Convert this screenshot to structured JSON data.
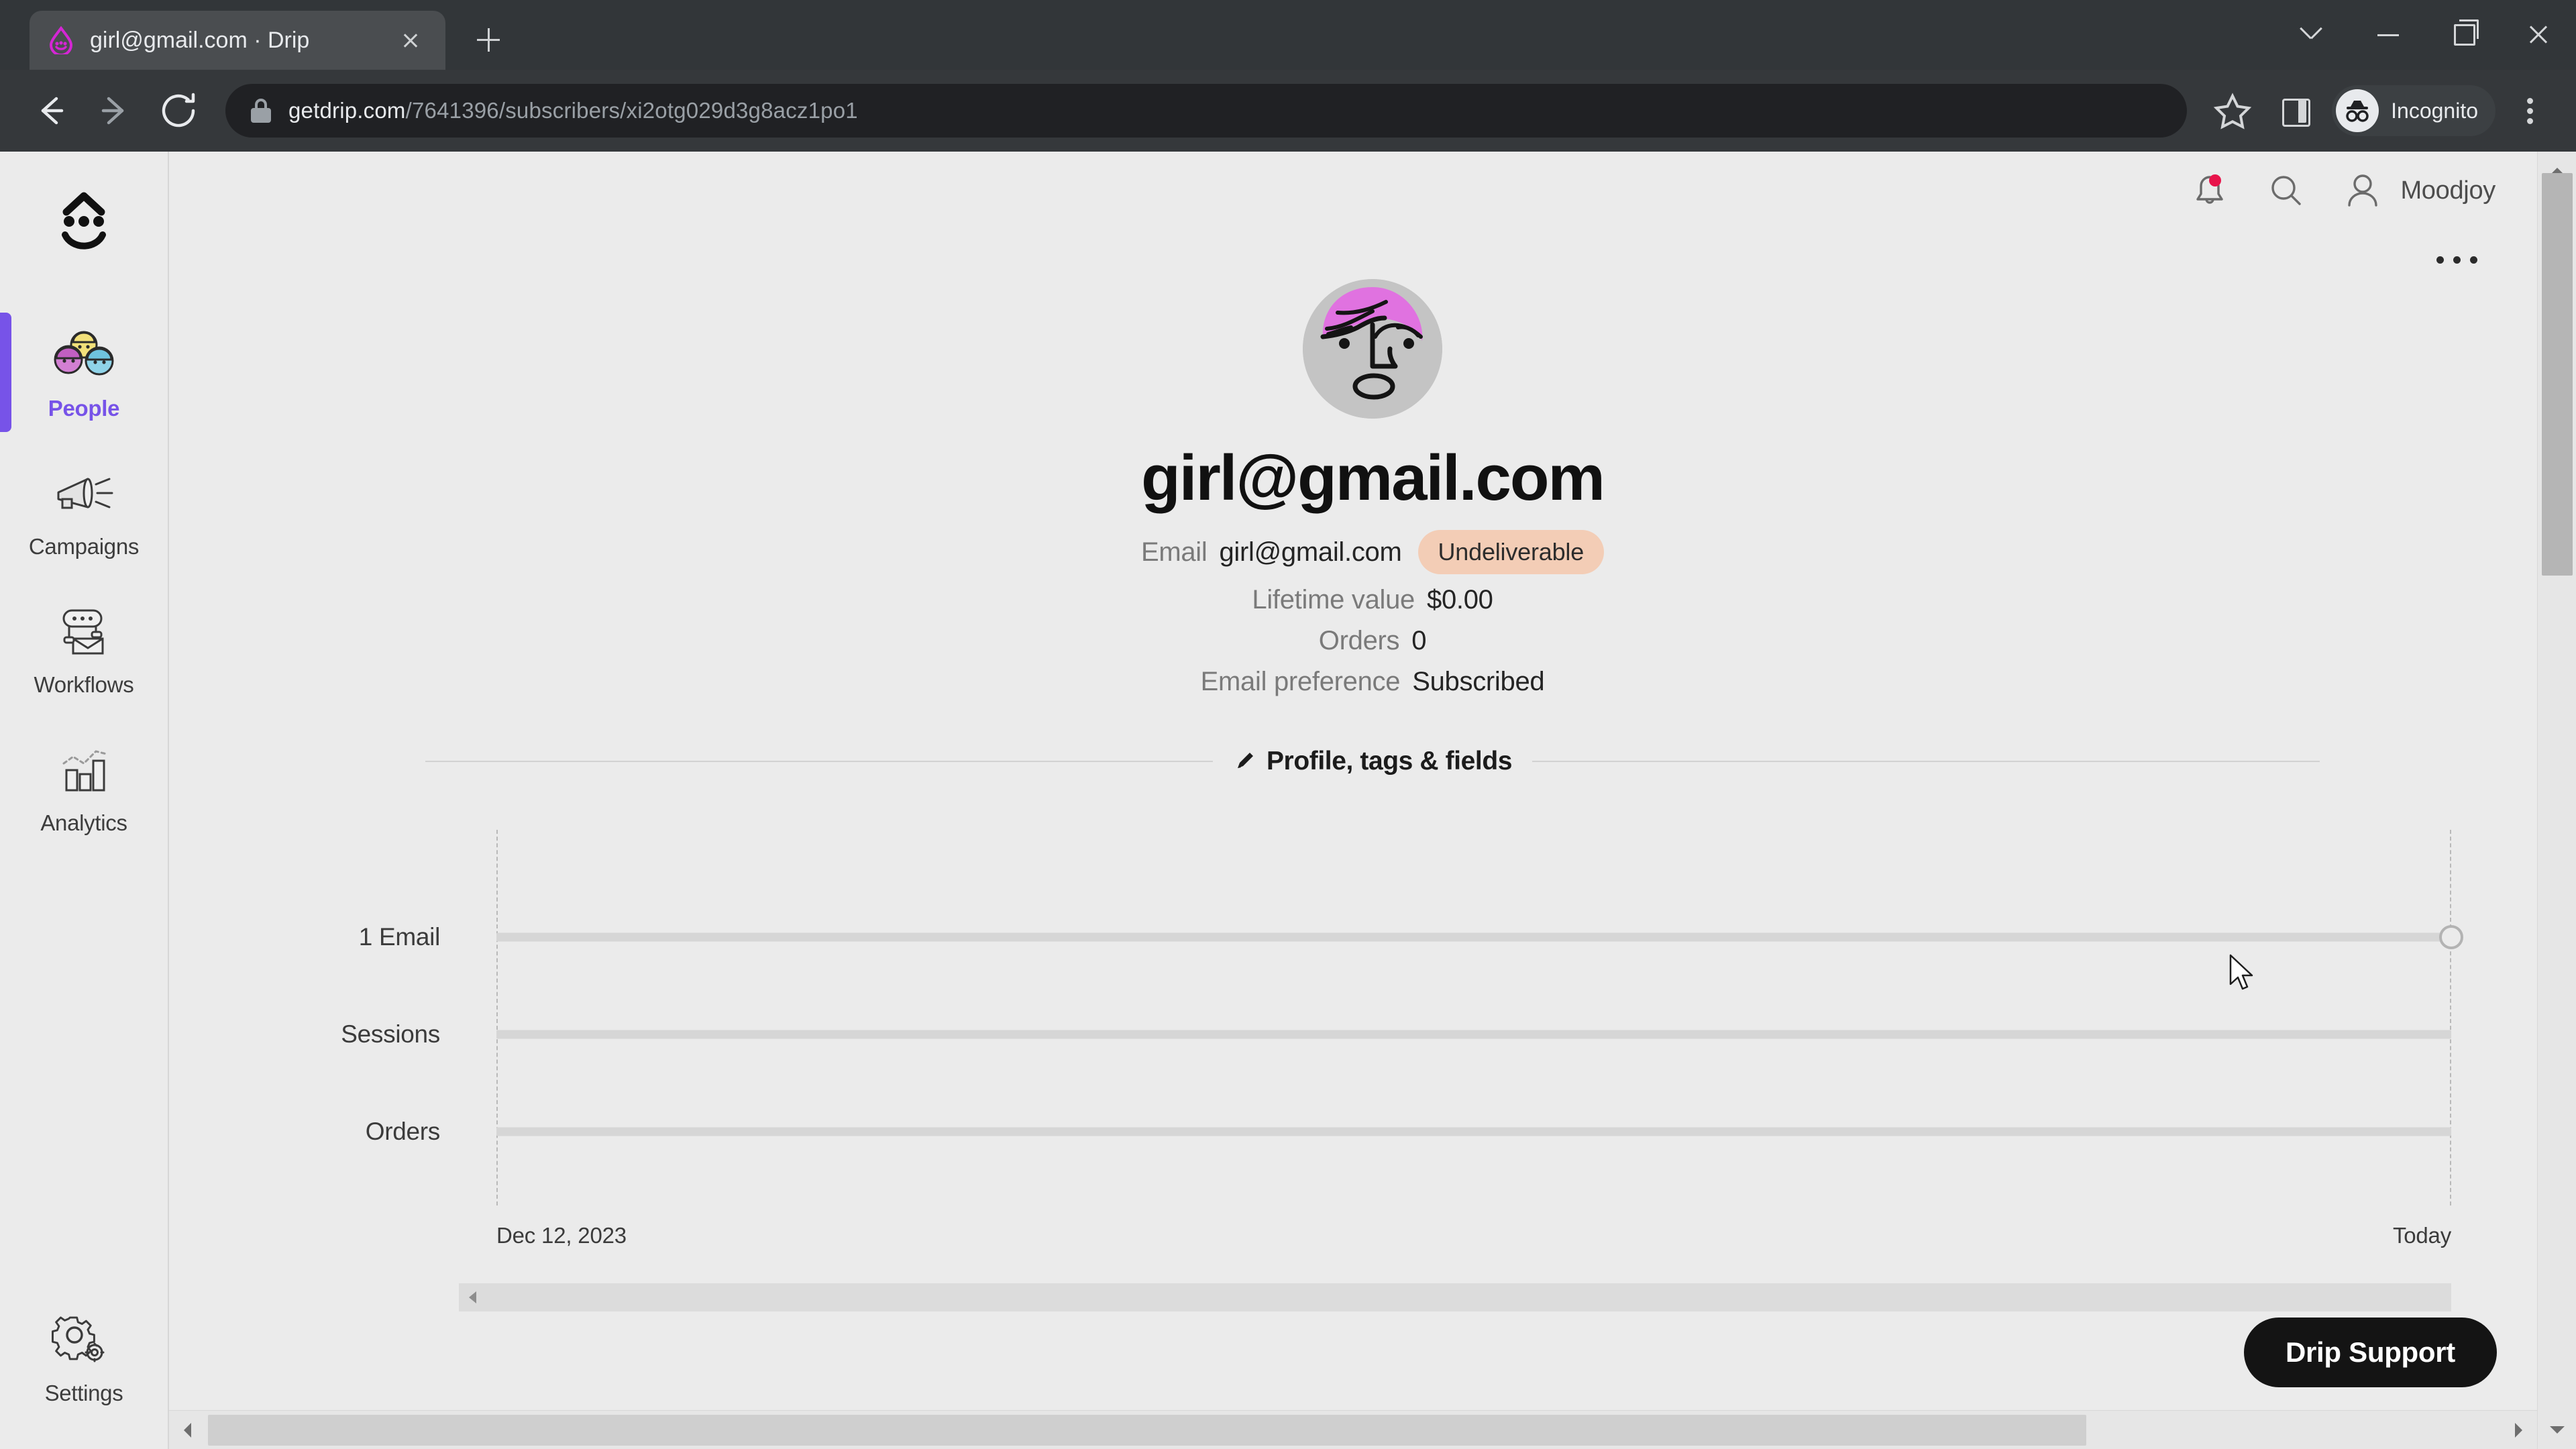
{
  "browser": {
    "tab": {
      "title": "girl@gmail.com · Drip",
      "favicon_name": "drip-logo-favicon",
      "close_name": "tab-close-icon"
    },
    "new_tab_label": "+",
    "window_controls": [
      "chevron-down-icon",
      "minimize-icon",
      "restore-icon",
      "close-icon"
    ],
    "toolbar": {
      "back_name": "back-arrow-icon",
      "forward_name": "forward-arrow-icon",
      "reload_name": "reload-icon",
      "lock_name": "lock-icon",
      "url_host": "getdrip.com",
      "url_path": "/7641396/subscribers/xi2otg029d3g8acz1po1",
      "star_name": "bookmark-star-icon",
      "side_panel_name": "side-panel-icon",
      "incognito_label": "Incognito",
      "menu_name": "browser-menu-icon"
    }
  },
  "sidebar": {
    "brand_name": "drip-smile-logo",
    "items": [
      {
        "label": "People",
        "icon": "people-icon",
        "active": true
      },
      {
        "label": "Campaigns",
        "icon": "megaphone-icon",
        "active": false
      },
      {
        "label": "Workflows",
        "icon": "workflow-icon",
        "active": false
      },
      {
        "label": "Analytics",
        "icon": "bar-chart-icon",
        "active": false
      },
      {
        "label": "Settings",
        "icon": "gear-icon",
        "active": false
      }
    ],
    "active_color": "#7753e8"
  },
  "header": {
    "notifications_name": "bell-icon",
    "notification_dot_color": "#e8144b",
    "search_name": "search-icon",
    "account_icon_name": "person-icon",
    "account_name": "Moodjoy"
  },
  "subscriber": {
    "more_menu_name": "more-options-icon",
    "avatar_name": "subscriber-avatar",
    "avatar_hair_color": "#e072e0",
    "avatar_face_color": "#c4c4c4",
    "name": "girl@gmail.com",
    "fields": [
      {
        "label": "Email",
        "value": "girl@gmail.com",
        "badge": "Undeliverable"
      },
      {
        "label": "Lifetime value",
        "value": "$0.00",
        "badge": null
      },
      {
        "label": "Orders",
        "value": "0",
        "badge": null
      },
      {
        "label": "Email preference",
        "value": "Subscribed",
        "badge": null
      }
    ],
    "badge_bg": "#f3cdb6"
  },
  "section": {
    "edit_icon": "pencil-icon",
    "label": "Profile, tags & fields"
  },
  "chart_data": {
    "type": "timeline",
    "title": "",
    "categories": [
      "1 Email",
      "Sessions",
      "Orders"
    ],
    "series": [
      {
        "name": "1 Email",
        "value": 1,
        "marker_at": "Today",
        "has_marker": true
      },
      {
        "name": "Sessions",
        "value": 0,
        "marker_at": null,
        "has_marker": false
      },
      {
        "name": "Orders",
        "value": 0,
        "marker_at": null,
        "has_marker": false
      }
    ],
    "x_axis": {
      "start_label": "Dec 12, 2023",
      "end_label": "Today"
    },
    "grid": false,
    "legend": "none"
  },
  "support": {
    "label": "Drip Support"
  },
  "scrollbars": {
    "vertical_name": "page-vertical-scrollbar",
    "horizontal_name": "page-horizontal-scrollbar",
    "timeline_horizontal_name": "timeline-horizontal-scrollbar"
  }
}
